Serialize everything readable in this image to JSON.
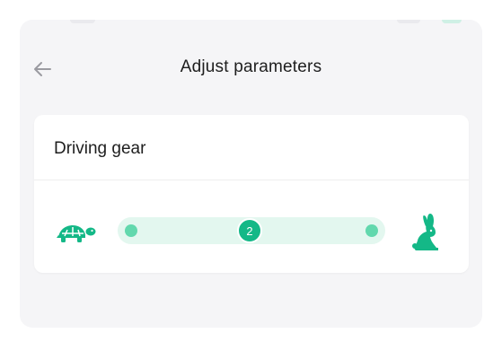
{
  "header": {
    "title": "Adjust parameters"
  },
  "card": {
    "title": "Driving gear",
    "slider": {
      "value": "2",
      "stops": 3,
      "min_icon": "turtle-icon",
      "max_icon": "rabbit-icon"
    }
  },
  "icons": {
    "back": "back-arrow-icon"
  },
  "colors": {
    "accent": "#14b887",
    "track": "#e3f7ef",
    "stop": "#62d8ad",
    "background": "#f5f5f7",
    "card": "#ffffff"
  }
}
